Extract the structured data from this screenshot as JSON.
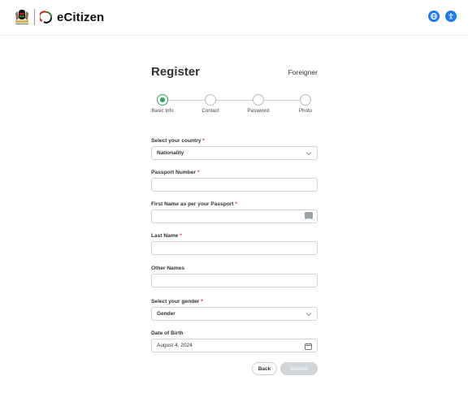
{
  "header": {
    "brand_name": "eCitizen",
    "icons": [
      "translate-icon",
      "accessibility-icon"
    ]
  },
  "form": {
    "title": "Register",
    "account_type": "Foreigner",
    "steps": [
      {
        "label": "Basic Info",
        "active": true
      },
      {
        "label": "Contact",
        "active": false
      },
      {
        "label": "Password",
        "active": false
      },
      {
        "label": "Photo",
        "active": false
      }
    ],
    "country": {
      "label": "Select your country",
      "required_mark": "*",
      "value": "Nationality"
    },
    "passport": {
      "label": "Passport Number",
      "required_mark": "*",
      "value": ""
    },
    "first_name": {
      "label": "First Name as per your Passport",
      "required_mark": "*",
      "value": ""
    },
    "last_name": {
      "label": "Last Name",
      "required_mark": "*",
      "value": ""
    },
    "other_names": {
      "label": "Other Names",
      "value": ""
    },
    "gender": {
      "label": "Select your gender",
      "required_mark": "*",
      "value": "Gender"
    },
    "dob": {
      "label": "Date of Birth",
      "value": "August 4, 2024"
    },
    "back_label": "Back",
    "submit_label": "Submit"
  },
  "colors": {
    "accent": "#2ea55a",
    "icon_blue": "#1e7bf2",
    "required": "#d9342b",
    "submit_disabled": "#d2d5d8"
  }
}
